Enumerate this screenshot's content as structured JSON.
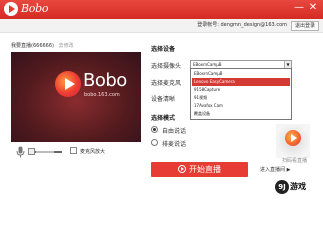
{
  "window": {
    "title": "Bobo",
    "controls": [
      "—",
      "✕"
    ]
  },
  "account": {
    "text": "登录帐号: dengmn_design@163.com",
    "logout_label": "退出登录"
  },
  "room": {
    "info": "我要直播(666666)",
    "edit_link": "去修改"
  },
  "preview": {
    "brand": "Bobo",
    "url": "bobo.163.com"
  },
  "audio": {
    "amplify_label": "麦克风放大",
    "volume": 0.15,
    "amplify_checked": false
  },
  "settings": {
    "section_title": "选择设备",
    "camera_label": "选择摄像头",
    "camera_value": "EBoxrnCamµB",
    "mic_label": "选择麦克风",
    "quality_label": "设备清晰",
    "camera_options": [
      {
        "label": "EBoxrnCamµB",
        "selected": false
      },
      {
        "label": "Lenovo EasyCamera",
        "selected": true
      },
      {
        "label": "9158Capture",
        "selected": false
      },
      {
        "label": "91视频",
        "selected": false
      },
      {
        "label": "17Avafox Cam",
        "selected": false
      },
      {
        "label": "覆盖设备",
        "selected": false
      }
    ]
  },
  "mode": {
    "section_title": "选择模式",
    "options": [
      {
        "label": "自由说话",
        "selected": true
      },
      {
        "label": "排麦说话",
        "selected": false
      }
    ]
  },
  "actions": {
    "start_label": "开始直播",
    "enter_room_label": "进入直播间 ▶"
  },
  "qr": {
    "caption": "扫码看直播"
  },
  "watermark": {
    "badge": "9J",
    "text": "游戏"
  }
}
